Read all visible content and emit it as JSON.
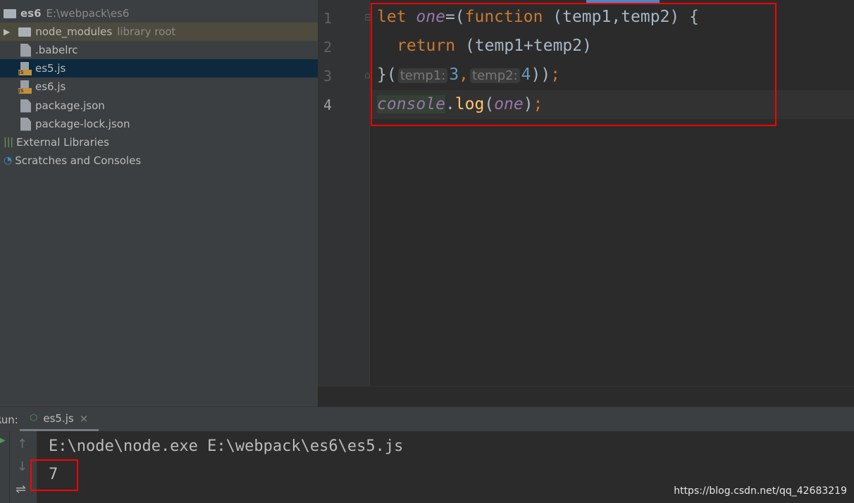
{
  "project": {
    "name": "es6",
    "path": "E:\\webpack\\es6"
  },
  "tree": [
    {
      "label": "node_modules",
      "note": "library root",
      "icon": "folder-icon"
    },
    {
      "label": ".babelrc",
      "icon": "config-file-icon"
    },
    {
      "label": "es5.js",
      "icon": "js-file-icon",
      "selected": true
    },
    {
      "label": "es6.js",
      "icon": "js-file-icon"
    },
    {
      "label": "package.json",
      "icon": "json-file-icon"
    },
    {
      "label": "package-lock.json",
      "icon": "json-file-icon"
    },
    {
      "label": "External Libraries",
      "icon": "libraries-icon"
    },
    {
      "label": "Scratches and Consoles",
      "icon": "scratches-icon"
    }
  ],
  "editor": {
    "line_numbers": [
      "1",
      "2",
      "3",
      "4"
    ],
    "line1": {
      "kw1": "let ",
      "var": "one",
      "p1": "=(",
      "kw2": "function",
      "rest": " (temp1,temp2) {"
    },
    "line2": {
      "kw": "return",
      "rest": " (temp1+temp2)"
    },
    "line3": {
      "p1": "}(",
      "hint1": "temp1:",
      "n1": "3",
      "c": ",",
      "hint2": "temp2:",
      "n2": "4",
      "p2": "))",
      "semi": ";"
    },
    "line4": {
      "obj": "console",
      "dot": ".",
      "fn": "log",
      "p1": "(",
      "arg": "one",
      "p2": ")",
      "semi": ";"
    }
  },
  "run": {
    "label": "Run:",
    "tab": "es5.js",
    "close": "×"
  },
  "console": {
    "command": "E:\\node\\node.exe E:\\webpack\\es6\\es5.js",
    "output": "7"
  },
  "watermark": "https://blog.csdn.net/qq_42683219"
}
